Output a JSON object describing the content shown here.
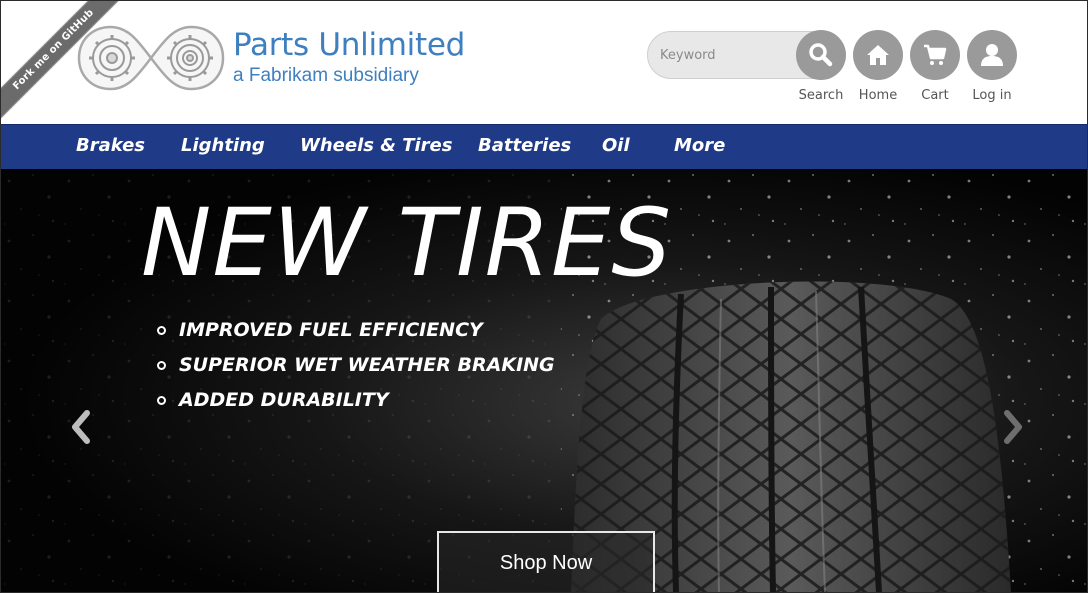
{
  "ribbon": {
    "label": "Fork me on GitHub"
  },
  "brand": {
    "title": "Parts Unlimited",
    "subtitle": "a Fabrikam subsidiary",
    "color": "#3e7fc0"
  },
  "search": {
    "placeholder": "Keyword",
    "value": ""
  },
  "header_buttons": {
    "search": {
      "label": "Search",
      "icon": "magnifier-icon"
    },
    "home": {
      "label": "Home",
      "icon": "house-icon"
    },
    "cart": {
      "label": "Cart",
      "icon": "cart-icon"
    },
    "login": {
      "label": "Log in",
      "icon": "user-icon"
    }
  },
  "nav": {
    "background": "#1f3a86",
    "items": [
      {
        "label": "Brakes"
      },
      {
        "label": "Lighting"
      },
      {
        "label": "Wheels & Tires"
      },
      {
        "label": "Batteries"
      },
      {
        "label": "Oil"
      },
      {
        "label": "More"
      }
    ]
  },
  "hero": {
    "title": "NEW TIRES",
    "features": [
      "IMPROVED FUEL EFFICIENCY",
      "SUPERIOR WET WEATHER BRAKING",
      "ADDED DURABILITY"
    ],
    "cta": "Shop Now",
    "prev_icon": "chevron-left-icon",
    "next_icon": "chevron-right-icon"
  }
}
